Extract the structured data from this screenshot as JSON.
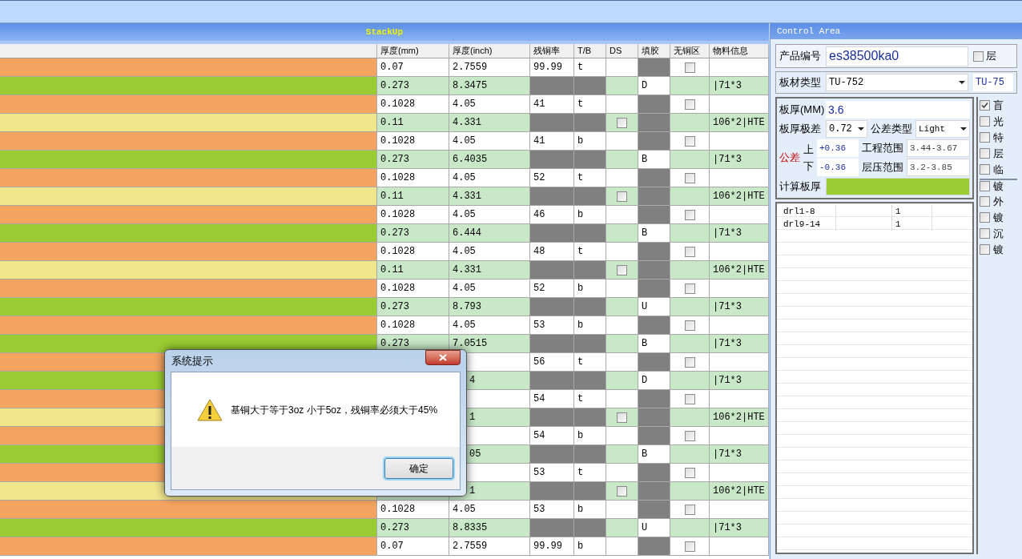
{
  "stackup": {
    "title": "StackUp",
    "columns": [
      "厚度(mm)",
      "厚度(inch)",
      "残铜率",
      "T/B",
      "DS",
      "填胶",
      "无铜区",
      "物料信息"
    ],
    "rows": [
      {
        "kind": "copper",
        "thickness": "0.07",
        "inch": "2.7559",
        "residual": "99.99",
        "tb": "t",
        "no_copper": {
          "checked": false
        }
      },
      {
        "kind": "core",
        "thickness": "0.273",
        "inch": "8.3475",
        "fill": "D",
        "material": "|71*3"
      },
      {
        "kind": "copper",
        "thickness": "0.1028",
        "inch": "4.05",
        "residual": "41",
        "tb": "t",
        "no_copper": {
          "checked": false
        }
      },
      {
        "kind": "prepreg",
        "thickness": "0.11",
        "inch": "4.331",
        "ds": {
          "checked": false
        },
        "material": "106*2|HTE"
      },
      {
        "kind": "copper",
        "thickness": "0.1028",
        "inch": "4.05",
        "residual": "41",
        "tb": "b",
        "no_copper": {
          "checked": false
        }
      },
      {
        "kind": "core",
        "thickness": "0.273",
        "inch": "6.4035",
        "fill": "B",
        "material": "|71*3"
      },
      {
        "kind": "copper",
        "thickness": "0.1028",
        "inch": "4.05",
        "residual": "52",
        "tb": "t",
        "no_copper": {
          "checked": false
        }
      },
      {
        "kind": "prepreg",
        "thickness": "0.11",
        "inch": "4.331",
        "ds": {
          "checked": false
        },
        "material": "106*2|HTE"
      },
      {
        "kind": "copper",
        "thickness": "0.1028",
        "inch": "4.05",
        "residual": "46",
        "tb": "b",
        "no_copper": {
          "checked": false
        }
      },
      {
        "kind": "core",
        "thickness": "0.273",
        "inch": "6.444",
        "fill": "B",
        "material": "|71*3"
      },
      {
        "kind": "copper",
        "thickness": "0.1028",
        "inch": "4.05",
        "residual": "48",
        "tb": "t",
        "no_copper": {
          "checked": false
        }
      },
      {
        "kind": "prepreg",
        "thickness": "0.11",
        "inch": "4.331",
        "ds": {
          "checked": false
        },
        "material": "106*2|HTE"
      },
      {
        "kind": "copper",
        "thickness": "0.1028",
        "inch": "4.05",
        "residual": "52",
        "tb": "b",
        "no_copper": {
          "checked": false
        }
      },
      {
        "kind": "core",
        "thickness": "0.273",
        "inch": "8.793",
        "fill": "U",
        "material": "|71*3"
      },
      {
        "kind": "copper",
        "thickness": "0.1028",
        "inch": "4.05",
        "residual": "53",
        "tb": "b",
        "no_copper": {
          "checked": false
        }
      },
      {
        "kind": "core",
        "thickness": "0.273",
        "inch": "7.0515",
        "fill": "B",
        "material": "|71*3"
      },
      {
        "kind": "copper",
        "residual": "56",
        "tb": "t",
        "no_copper": {
          "checked": false
        }
      },
      {
        "kind": "core",
        "inch_tail": "4",
        "fill": "D",
        "material": "|71*3"
      },
      {
        "kind": "copper",
        "residual": "54",
        "tb": "t",
        "no_copper": {
          "checked": false
        }
      },
      {
        "kind": "prepreg",
        "inch_tail": "1",
        "ds": {
          "checked": false
        },
        "material": "106*2|HTE"
      },
      {
        "kind": "copper",
        "residual": "54",
        "tb": "b",
        "no_copper": {
          "checked": false
        }
      },
      {
        "kind": "core",
        "inch_tail": "05",
        "fill": "B",
        "material": "|71*3"
      },
      {
        "kind": "copper",
        "residual": "53",
        "tb": "t",
        "no_copper": {
          "checked": false
        }
      },
      {
        "kind": "prepreg",
        "inch_tail": "1",
        "ds": {
          "checked": false
        },
        "material": "106*2|HTE"
      },
      {
        "kind": "copper",
        "thickness": "0.1028",
        "inch": "4.05",
        "residual": "53",
        "tb": "b",
        "no_copper": {
          "checked": false
        }
      },
      {
        "kind": "core",
        "thickness": "0.273",
        "inch": "8.8335",
        "fill": "U",
        "material": "|71*3"
      },
      {
        "kind": "copper",
        "thickness": "0.07",
        "inch": "2.7559",
        "residual": "99.99",
        "tb": "b",
        "no_copper": {
          "checked": false
        }
      }
    ]
  },
  "control_area": {
    "title": "Control Area",
    "product": {
      "label": "产品编号",
      "value": "es38500ka0",
      "layer_check": {
        "label": "层",
        "checked": false
      }
    },
    "material": {
      "label": "板材类型",
      "value": "TU-752",
      "side_value": "TU-75"
    },
    "thickness": {
      "label": "板厚(MM)",
      "value": "3.6"
    },
    "range": {
      "label": "板厚极差",
      "value": "0.72"
    },
    "tolerance_type": {
      "label": "公差类型",
      "value": "Light"
    },
    "tolerance": {
      "label": "公差",
      "upper_label": "上",
      "upper": "+0.36",
      "lower_label": "下",
      "lower": "-0.36"
    },
    "engineering_range": {
      "label": "工程范围",
      "value": "3.44-3.67"
    },
    "press_range": {
      "label": "层压范围",
      "value": "3.2-3.85"
    },
    "computed": {
      "label": "计算板厚"
    },
    "drills": [
      {
        "name": "drl1-8",
        "count": "1"
      },
      {
        "name": "drl9-14",
        "count": "1"
      }
    ],
    "options": [
      {
        "label": "盲",
        "checked": true
      },
      {
        "label": "光",
        "checked": false
      },
      {
        "label": "特",
        "checked": false
      },
      {
        "label": "层",
        "checked": false
      },
      {
        "label": "临",
        "checked": false
      },
      {
        "label": "镀",
        "checked": false
      },
      {
        "label": "外",
        "checked": false
      },
      {
        "label": "镀",
        "checked": false
      },
      {
        "label": "沉",
        "checked": false
      },
      {
        "label": "镀",
        "checked": false
      }
    ]
  },
  "dialog": {
    "title": "系统提示",
    "message": "基铜大于等于3oz 小于5oz，残铜率必须大于45%",
    "button": "确定"
  }
}
